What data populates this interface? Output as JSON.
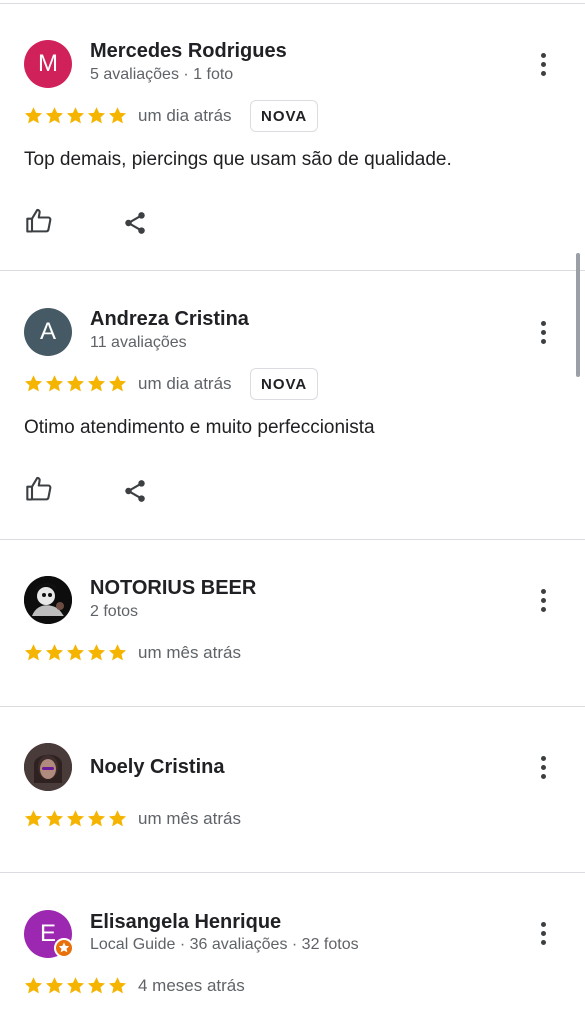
{
  "colors": {
    "star": "#f4b400",
    "divider": "#dadce0",
    "avatar_m": "#d0215b",
    "avatar_a": "#455a64",
    "avatar_e": "#9c27b0",
    "local_guide_badge": "#e8710a"
  },
  "reviews": [
    {
      "avatar_letter": "M",
      "name": "Mercedes Rodrigues",
      "meta": "5 avaliações · 1 foto",
      "rating": 5,
      "time": "um dia atrás",
      "badge": "NOVA",
      "text": "Top demais, piercings que usam são de qualidade."
    },
    {
      "avatar_letter": "A",
      "name": "Andreza Cristina",
      "meta": "11 avaliações",
      "rating": 5,
      "time": "um dia atrás",
      "badge": "NOVA",
      "text": "Otimo atendimento e muito perfeccionista"
    },
    {
      "name": "NOTORIUS BEER",
      "meta": "2 fotos",
      "rating": 5,
      "time": "um mês atrás"
    },
    {
      "name": "Noely Cristina",
      "rating": 5,
      "time": "um mês atrás"
    },
    {
      "avatar_letter": "E",
      "name": "Elisangela Henrique",
      "meta": "Local Guide · 36 avaliações · 32 fotos",
      "rating": 5,
      "time": "4 meses atrás"
    }
  ],
  "icons": {
    "like": "thumb-up-icon",
    "share": "share-icon",
    "more": "more-vert-icon",
    "star": "star-icon"
  }
}
